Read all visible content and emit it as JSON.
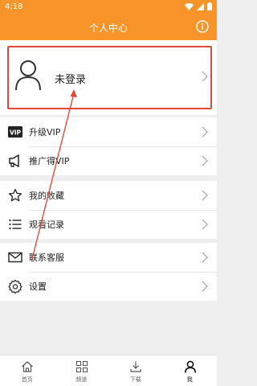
{
  "status_bar": {
    "time": "4:18"
  },
  "header": {
    "title": "个人中心",
    "info_icon": "info-icon",
    "color": "#f7942a"
  },
  "login": {
    "label": "未登录",
    "highlight_color": "#e04a35"
  },
  "menu": {
    "group1": [
      {
        "icon": "vip-icon",
        "label": "升级VIP"
      },
      {
        "icon": "megaphone-icon",
        "label": "推广得VIP"
      }
    ],
    "group2": [
      {
        "icon": "star-icon",
        "label": "我的收藏"
      },
      {
        "icon": "list-icon",
        "label": "观看记录"
      }
    ],
    "group3": [
      {
        "icon": "mail-icon",
        "label": "联系客服"
      },
      {
        "icon": "gear-icon",
        "label": "设置"
      }
    ]
  },
  "tabs": [
    {
      "icon": "home-icon",
      "label": "首页"
    },
    {
      "icon": "grid-icon",
      "label": "频道"
    },
    {
      "icon": "download-icon",
      "label": "下载"
    },
    {
      "icon": "user-icon",
      "label": "我",
      "active": true
    }
  ],
  "annotation": {
    "arrow_color": "#e04a35"
  }
}
